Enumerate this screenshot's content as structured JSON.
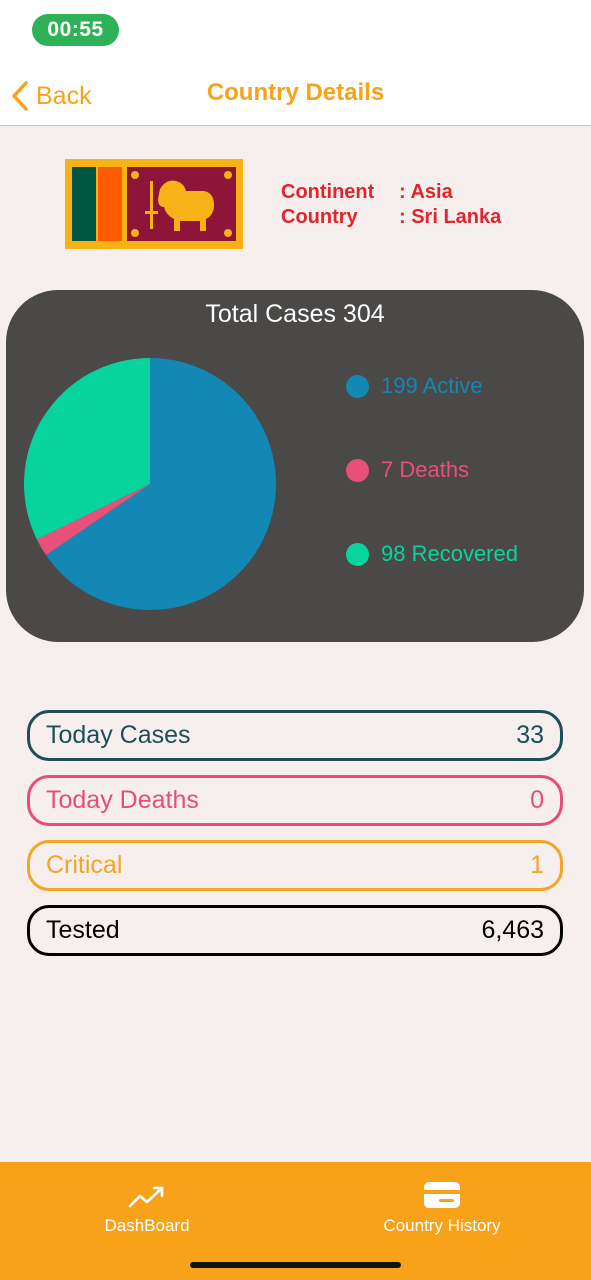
{
  "status_bar": {
    "time": "00:55"
  },
  "nav": {
    "back_label": "Back",
    "title": "Country Details"
  },
  "country_info": {
    "continent_key": "Continent",
    "continent_value": ": Asia",
    "country_key": "Country",
    "country_value": ": Sri Lanka"
  },
  "chart_data": {
    "type": "pie",
    "title": "Total Cases 304",
    "series": [
      {
        "name": "Active",
        "value": 199,
        "label": "199 Active",
        "color": "#1488b5"
      },
      {
        "name": "Deaths",
        "value": 7,
        "label": "7 Deaths",
        "color": "#e84f79"
      },
      {
        "name": "Recovered",
        "value": 98,
        "label": "98 Recovered",
        "color": "#07d49c"
      }
    ],
    "legend_placement": "right"
  },
  "stats": [
    {
      "label": "Today Cases",
      "value": "33",
      "color": "#1d4e5a"
    },
    {
      "label": "Today Deaths",
      "value": "0",
      "color": "#e84d78"
    },
    {
      "label": "Critical",
      "value": "1",
      "color": "#f3a526"
    },
    {
      "label": "Tested",
      "value": "6,463",
      "color": "#000000"
    }
  ],
  "tabbar": {
    "items": [
      {
        "label": "DashBoard",
        "icon": "trending-up-icon"
      },
      {
        "label": "Country History",
        "icon": "card-icon"
      }
    ]
  }
}
